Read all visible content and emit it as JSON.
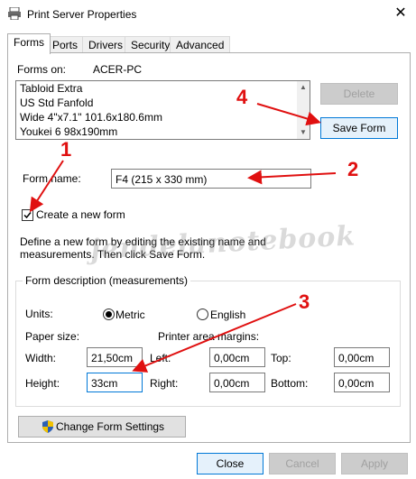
{
  "window": {
    "title": "Print Server Properties",
    "close_glyph": "✕"
  },
  "tabs": [
    "Forms",
    "Ports",
    "Drivers",
    "Security",
    "Advanced"
  ],
  "forms_on": {
    "label": "Forms on:",
    "computer": "ACER-PC"
  },
  "forms_list": [
    "Tabloid Extra",
    "US Std Fanfold",
    "Wide 4\"x7.1\" 101.6x180.6mm",
    "Youkei 6 98x190mm"
  ],
  "buttons": {
    "delete": "Delete",
    "save_form": "Save Form",
    "change_form_settings": "Change Form Settings",
    "close": "Close",
    "cancel": "Cancel",
    "apply": "Apply"
  },
  "form_name": {
    "label": "Form name:",
    "value": "F4 (215 x 330 mm)"
  },
  "create_new_form": {
    "label": "Create a new form",
    "checked": true
  },
  "instructions": {
    "line1": "Define a new form by editing the existing name and",
    "line2": "measurements. Then click Save Form."
  },
  "form_description": {
    "title": "Form description (measurements)",
    "units_label": "Units:",
    "metric_label": "Metric",
    "english_label": "English",
    "selected_unit": "Metric",
    "paper_size_label": "Paper size:",
    "printer_margins_label": "Printer area margins:",
    "width_label": "Width:",
    "width_value": "21,50cm",
    "height_label": "Height:",
    "height_value": "33cm",
    "left_label": "Left:",
    "left_value": "0,00cm",
    "right_label": "Right:",
    "right_value": "0,00cm",
    "top_label": "Top:",
    "top_value": "0,00cm",
    "bottom_label": "Bottom:",
    "bottom_value": "0,00cm"
  },
  "watermark": "jendelanotebook",
  "annotations": {
    "n1": "1",
    "n2": "2",
    "n3": "3",
    "n4": "4",
    "color": "#e01010"
  }
}
